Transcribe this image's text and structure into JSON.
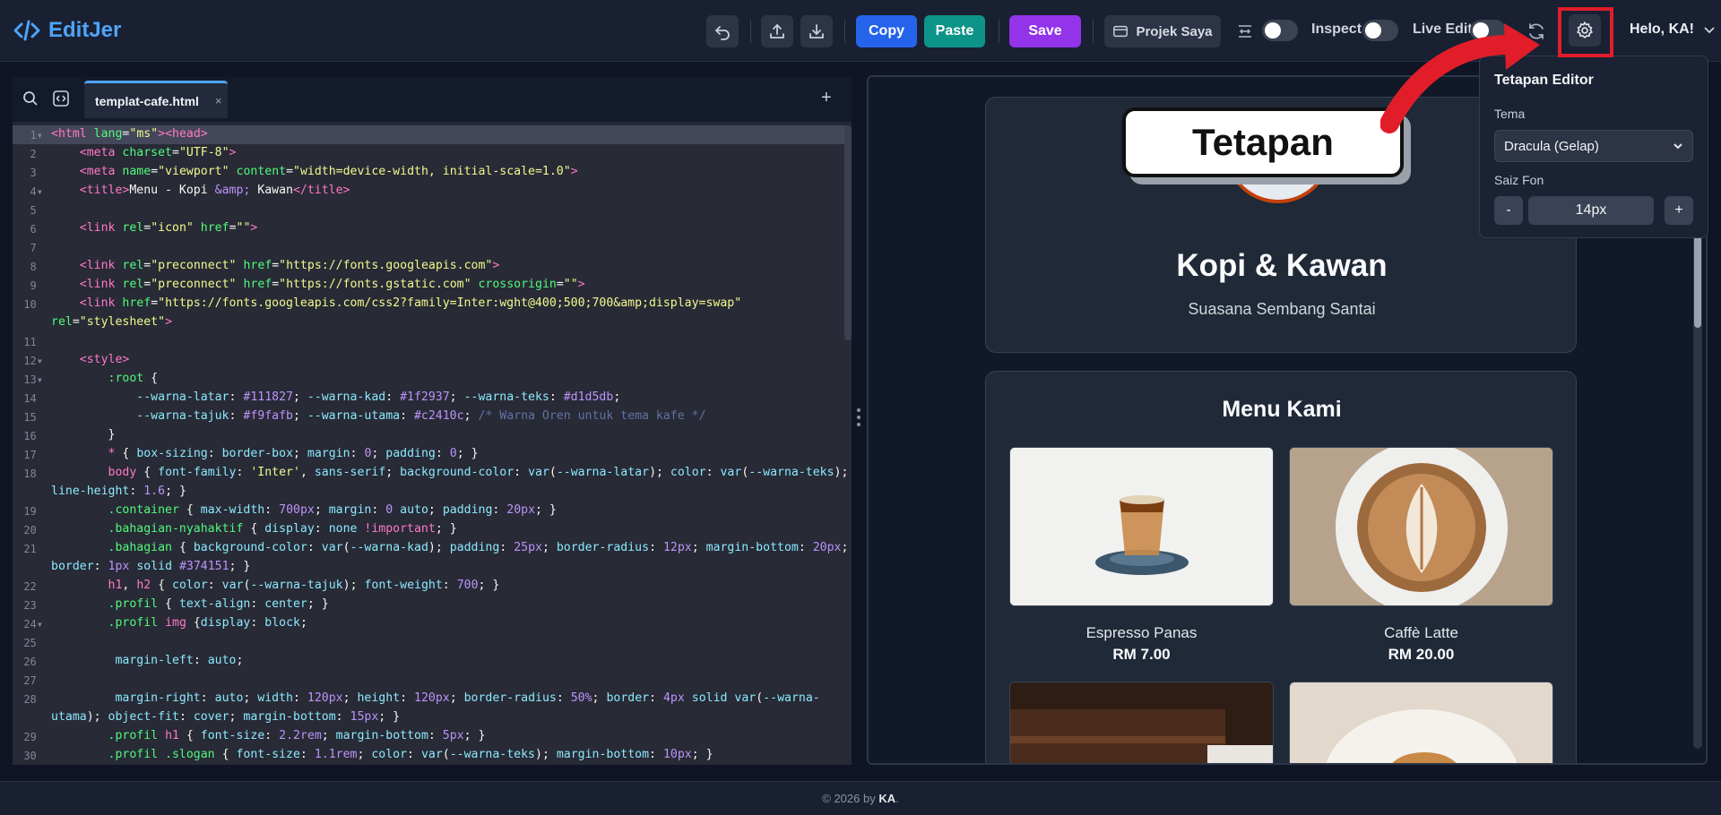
{
  "header": {
    "brand": "EditJer",
    "copy_label": "Copy",
    "paste_label": "Paste",
    "save_label": "Save",
    "projects_label": "Projek Saya",
    "inspect_label": "Inspect",
    "live_edit_label": "Live Edit",
    "user_label": "Helo, KA!",
    "colors": {
      "copy": "#2563eb",
      "paste": "#0d9488",
      "save": "#9333ea",
      "brand": "#4fa3f7"
    }
  },
  "editor": {
    "tab_name": "templat-cafe.html",
    "tab_close": "×",
    "add_tab": "+",
    "line_numbers": [
      "1",
      "2",
      "3",
      "4",
      "5",
      "6",
      "7",
      "8",
      "9",
      "10",
      "11",
      "12",
      "13",
      "14",
      "15",
      "16",
      "17",
      "18",
      "19",
      "20",
      "21",
      "22",
      "23",
      "24",
      "25",
      "26",
      "27",
      "28",
      "29",
      "30"
    ],
    "fold_markers": [
      "1",
      "4",
      "12",
      "13",
      "24"
    ]
  },
  "preview": {
    "cafe_name": "Kopi & Kawan",
    "slogan": "Suasana Sembang Santai",
    "menu_title": "Menu Kami",
    "items": [
      {
        "name": "Espresso Panas",
        "price": "RM 7.00"
      },
      {
        "name": "Caffè Latte",
        "price": "RM 20.00"
      },
      {
        "name": "",
        "price": ""
      },
      {
        "name": "",
        "price": ""
      }
    ]
  },
  "settings": {
    "title": "Tetapan Editor",
    "theme_label": "Tema",
    "theme_value": "Dracula (Gelap)",
    "font_size_label": "Saiz Fon",
    "font_size_value": "14px",
    "decrease_label": "-",
    "increase_label": "+"
  },
  "callout": {
    "text": "Tetapan"
  },
  "footer": {
    "prefix": "© 2026 by",
    "author": "KA",
    "suffix": "."
  },
  "icons": [
    "code-brackets-icon",
    "undo-icon",
    "upload-icon",
    "download-icon",
    "window-icon",
    "wrap-icon",
    "refresh-icon",
    "gear-icon",
    "chevron-down-icon",
    "search-icon",
    "format-icon"
  ]
}
